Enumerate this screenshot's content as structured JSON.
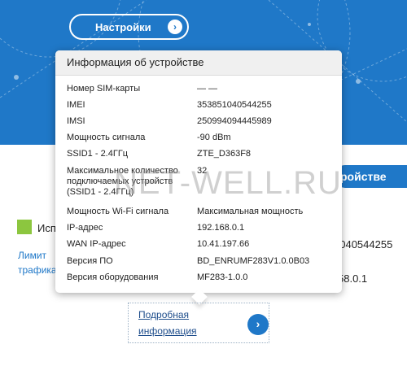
{
  "header": {
    "settings_label": "Настройки"
  },
  "background": {
    "device_button_partial": "ройстве",
    "status_partial": "Исп",
    "limit_link_line1": "Лимит",
    "limit_link_line2": "трафика",
    "imei_partial": "1040544255",
    "ip_partial": "58.0.1",
    "watermark": "NET-WELL.RU"
  },
  "popup": {
    "title": "Информация об устройстве",
    "rows": [
      {
        "label": "Номер SIM-карты",
        "value": "— —"
      },
      {
        "label": "IMEI",
        "value": "353851040544255"
      },
      {
        "label": "IMSI",
        "value": "250994094445989"
      },
      {
        "label": "Мощность сигнала",
        "value": "-90 dBm"
      },
      {
        "label": "SSID1 - 2.4ГГц",
        "value": "ZTE_D363F8"
      },
      {
        "label": "Максимальное количество подключаемых устройств (SSID1 - 2.4ГГц)",
        "value": "32"
      },
      {
        "label": "Мощность Wi-Fi сигнала",
        "value": "Максимальная мощность"
      },
      {
        "label": "IP-адрес",
        "value": "192.168.0.1"
      },
      {
        "label": "WAN IP-адрес",
        "value": "10.41.197.66"
      },
      {
        "label": "Версия ПО",
        "value": "BD_ENRUMF283V1.0.0B03"
      },
      {
        "label": "Версия оборудования",
        "value": "MF283-1.0.0"
      }
    ]
  },
  "details": {
    "link_label": "Подробная информация"
  },
  "colors": {
    "brand_blue": "#1f78c8",
    "green_status": "#8cc63f"
  }
}
